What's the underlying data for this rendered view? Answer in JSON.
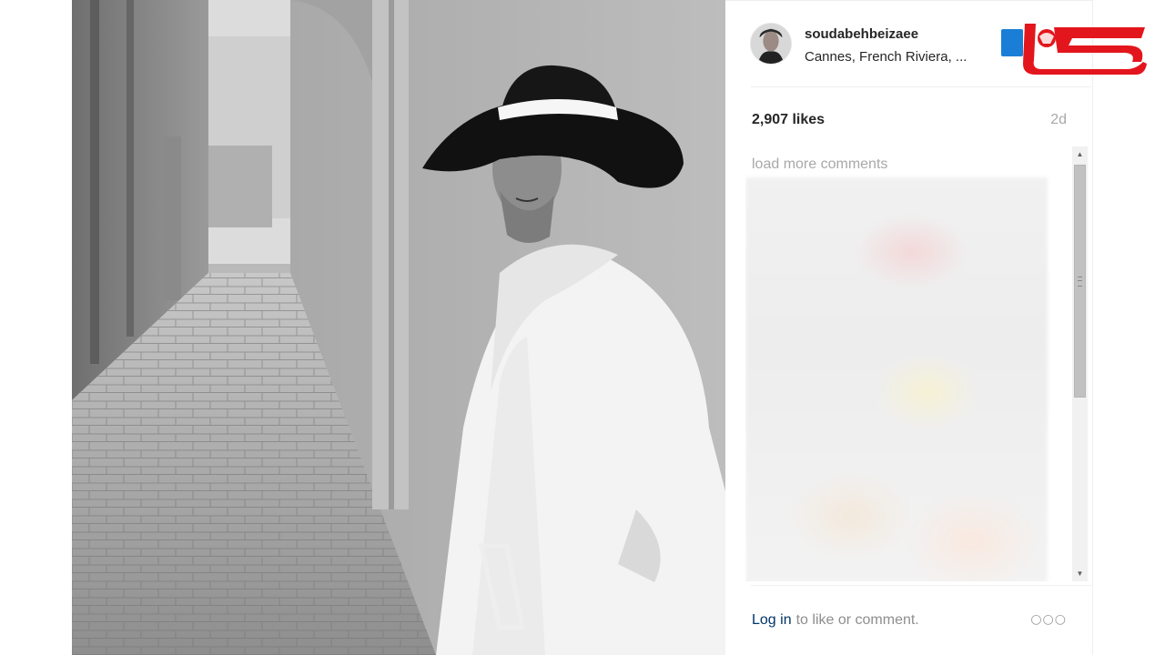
{
  "post": {
    "username": "soudabehbeizaee",
    "location": "Cannes, French Riviera, ...",
    "likes": "2,907 likes",
    "time_ago": "2d"
  },
  "comments": {
    "load_more_label": "load more comments"
  },
  "footer": {
    "login_label": "Log in",
    "login_suffix": "to like or comment.",
    "more_icon": "more-options-icon"
  },
  "colors": {
    "link": "#003569",
    "muted": "#a8a8a8",
    "text": "#262626",
    "logo_red": "#e3161d",
    "logo_blue": "#1a7ed6"
  }
}
